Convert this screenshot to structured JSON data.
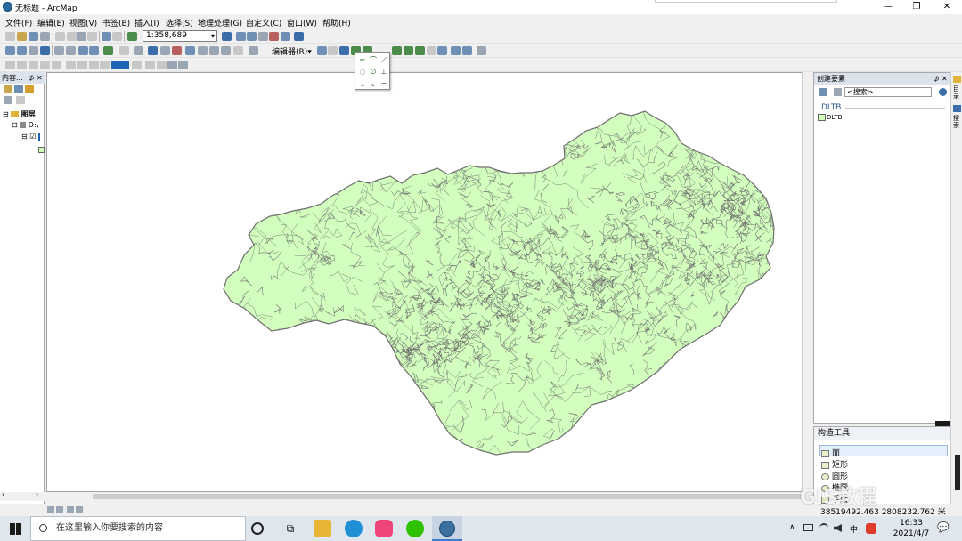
{
  "window": {
    "title": "无标题 - ArcMap",
    "minimize_glyph": "—",
    "maximize_glyph": "❐",
    "close_glyph": "✕"
  },
  "menu": [
    "文件(F)",
    "编辑(E)",
    "视图(V)",
    "书签(B)",
    "插入(I)",
    "选择(S)",
    "地理处理(G)",
    "自定义(C)",
    "窗口(W)",
    "帮助(H)"
  ],
  "toolbar": {
    "scale": "1:358,689",
    "editor_label": "编辑器(R)▾"
  },
  "toc": {
    "title": "内容...",
    "pin": "⊅",
    "close": "✕",
    "layers_label": "图层",
    "path_label": "D:\\",
    "expand_glyph": "⊟",
    "checkbox_glyph": "☑"
  },
  "create_features": {
    "title": "创建要素",
    "pin": "⊅",
    "close": "✕",
    "search_placeholder": "<搜索>",
    "group": "DLTB",
    "template": "DLTB"
  },
  "construction_tools": {
    "title": "构造工具",
    "tools": [
      "面",
      "矩形",
      "圆形",
      "椭圆",
      "手绘"
    ]
  },
  "right_tabs": [
    "目录",
    "搜索"
  ],
  "status": {
    "coordinates": "38519492.463  2808232.762 米"
  },
  "watermark": "GIS教程",
  "taskbar": {
    "search_placeholder": "在这里输入你要搜索的内容",
    "tray_lang": "中",
    "time": "16:33",
    "date": "2021/4/7",
    "notif_glyph": "💬",
    "chevron_glyph": "∧"
  },
  "colors": {
    "map_fill": "#d3ffbe",
    "map_line": "#6e6e6e",
    "panel_header": "#dde3ec",
    "accent": "#2a5a8a"
  },
  "icons": {
    "app": "arcmap-globe-icon",
    "taskbar": [
      "cortana-circle-icon",
      "task-view-icon",
      "file-explorer-icon",
      "edge-icon",
      "pink-app-icon",
      "wechat-icon",
      "arcmap-icon"
    ]
  }
}
